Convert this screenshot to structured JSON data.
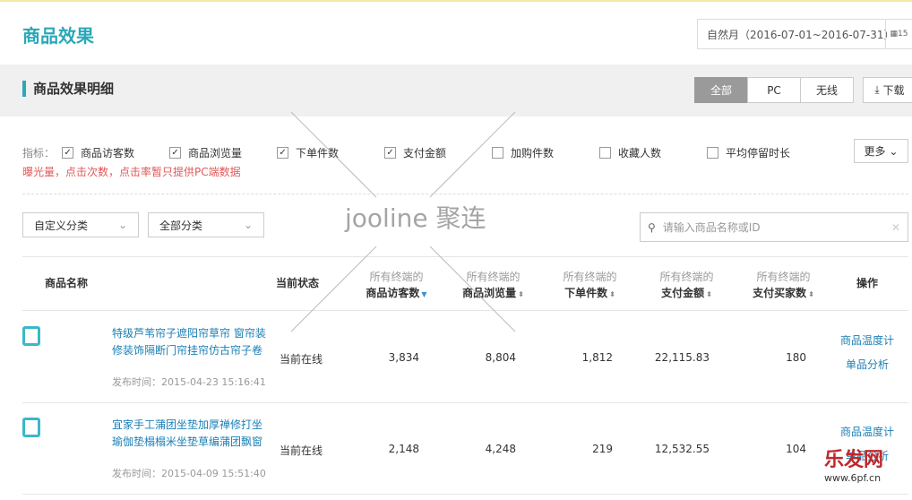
{
  "page": {
    "title": "商品效果",
    "date_range": "自然月（2016-07-01~2016-07-31）",
    "calendar_icon_day": "15"
  },
  "section": {
    "title": "商品效果明细",
    "tabs": [
      "全部",
      "PC",
      "无线"
    ],
    "active_tab": "全部",
    "download": "下载"
  },
  "metrics": {
    "label": "指标：",
    "items": [
      {
        "label": "商品访客数",
        "checked": true
      },
      {
        "label": "商品浏览量",
        "checked": true
      },
      {
        "label": "下单件数",
        "checked": true
      },
      {
        "label": "支付金额",
        "checked": true
      },
      {
        "label": "加购件数",
        "checked": false
      },
      {
        "label": "收藏人数",
        "checked": false
      },
      {
        "label": "平均停留时长",
        "checked": false
      }
    ],
    "note": "曝光量，点击次数，点击率暂只提供PC端数据",
    "more": "更多"
  },
  "filters": {
    "custom_category": "自定义分类",
    "all_category": "全部分类",
    "search_placeholder": "请输入商品名称或ID"
  },
  "table": {
    "headers": [
      {
        "label": "商品名称"
      },
      {
        "label": "当前状态"
      },
      {
        "sub": "所有终端的",
        "label": "商品访客数"
      },
      {
        "sub": "所有终端的",
        "label": "商品浏览量"
      },
      {
        "sub": "所有终端的",
        "label": "下单件数"
      },
      {
        "sub": "所有终端的",
        "label": "支付金额"
      },
      {
        "sub": "所有终端的",
        "label": "支付买家数"
      },
      {
        "label": "操作"
      }
    ],
    "rows": [
      {
        "name": "特级芦苇帘子遮阳帘草帘 窗帘装修装饰隔断门帘挂帘仿古帘子卷",
        "published": "发布时间：2015-04-23 15:16:41",
        "status": "当前在线",
        "visitors": "3,834",
        "views": "8,804",
        "orders": "1,812",
        "amount": "22,115.83",
        "buyers": "180",
        "actions": [
          "商品温度计",
          "单品分析"
        ]
      },
      {
        "name": "宜家手工蒲团坐垫加厚禅修打坐瑜伽垫榻榻米坐垫草编蒲团飘窗",
        "published": "发布时间：2015-04-09 15:51:40",
        "status": "当前在线",
        "visitors": "2,148",
        "views": "4,248",
        "orders": "219",
        "amount": "12,532.55",
        "buyers": "104",
        "actions": [
          "商品温度计",
          "单品分析"
        ]
      }
    ]
  },
  "watermarks": {
    "jooline": "jooline 聚连",
    "site": "乐发网",
    "site_url": "www.6pf.cn"
  },
  "colors": {
    "accent": "#2aa8b8",
    "link": "#1a7fb5",
    "warning": "#e0585a"
  }
}
